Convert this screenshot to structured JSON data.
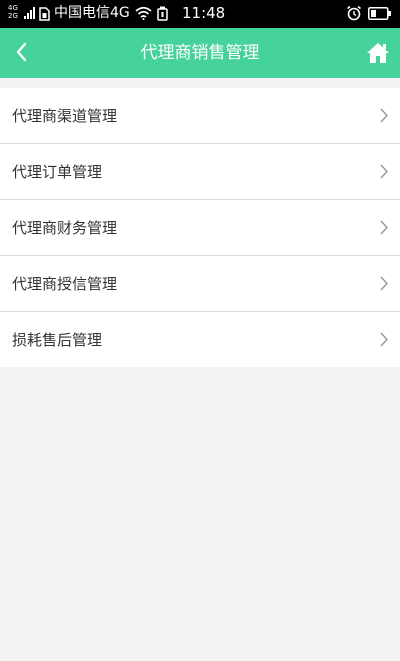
{
  "status_bar": {
    "network_types": [
      "4G",
      "2G"
    ],
    "carrier": "中国电信4G",
    "time": "11:48",
    "icons": [
      "signal-icon",
      "sim-icon",
      "wifi-icon",
      "usb-icon",
      "alarm-icon",
      "battery-icon"
    ]
  },
  "header": {
    "title": "代理商销售管理",
    "back_icon": "chevron-left-icon",
    "home_icon": "home-icon",
    "background": "#46d29b"
  },
  "menu": {
    "items": [
      {
        "label": "代理商渠道管理"
      },
      {
        "label": "代理订单管理"
      },
      {
        "label": "代理商财务管理"
      },
      {
        "label": "代理商授信管理"
      },
      {
        "label": "损耗售后管理"
      }
    ]
  },
  "colors": {
    "accent": "#46d29b",
    "page_background": "#f3f3f3",
    "text": "#333333",
    "divider": "#dedede"
  }
}
